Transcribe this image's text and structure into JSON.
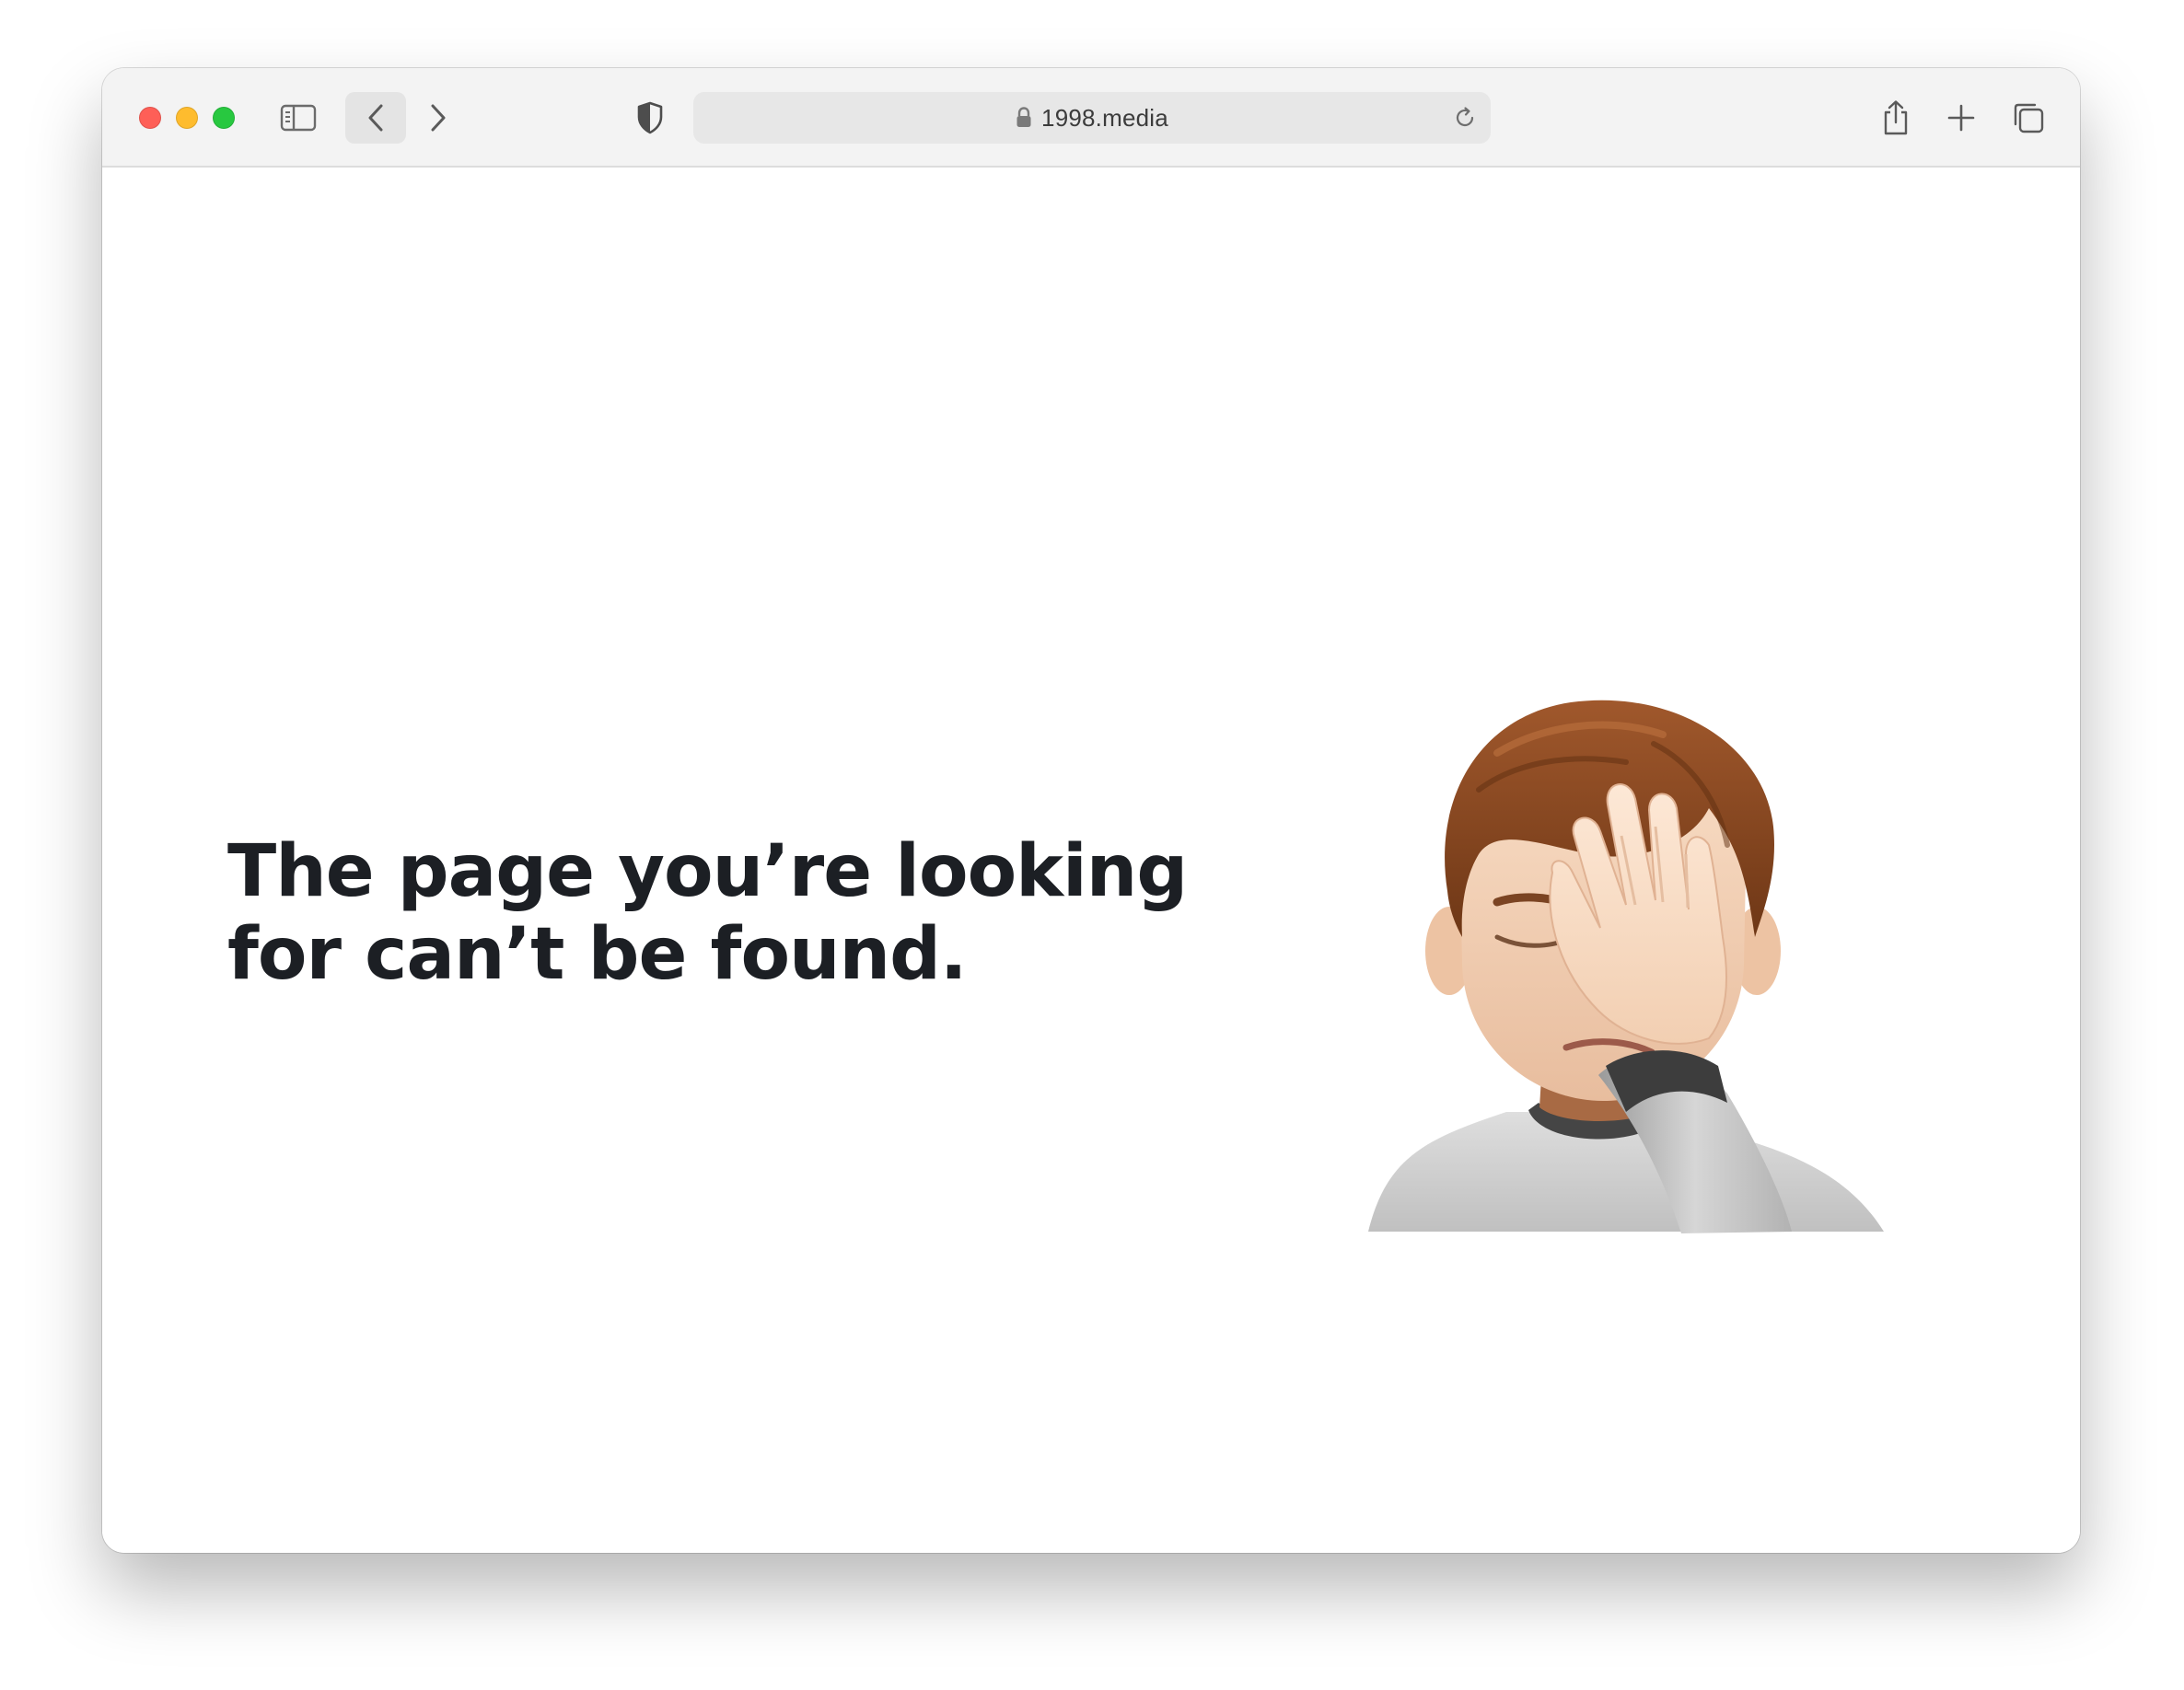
{
  "browser": {
    "url": "1998.media",
    "icons": {
      "close": "close-dot",
      "minimize": "minimize-dot",
      "zoom": "zoom-dot",
      "sidebar": "sidebar-icon",
      "back": "chevron-left-icon",
      "forward": "chevron-right-icon",
      "privacy": "shield-icon",
      "lock": "lock-icon",
      "reload": "reload-icon",
      "share": "share-icon",
      "new_tab": "plus-icon",
      "tabs": "tabs-overview-icon"
    },
    "colors": {
      "close": "#fe5f57",
      "minimize": "#febc2e",
      "zoom": "#28c840"
    }
  },
  "page": {
    "headline_line1": "The page you’re looking",
    "headline_line2": "for can’t be found.",
    "illustration": "facepalm-memoji",
    "text_color": "#1c1f24"
  }
}
